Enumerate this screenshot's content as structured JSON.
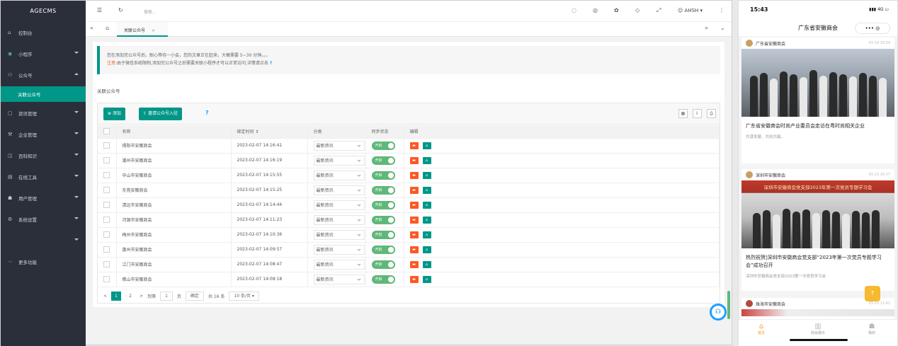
{
  "admin": {
    "brand": "AGECMS",
    "menu": [
      {
        "label": "控制台",
        "icon": "home-icon",
        "glyph": "⌂",
        "arrow": false
      },
      {
        "label": "小程序",
        "icon": "miniapp-icon",
        "glyph": "◉",
        "arrow": true
      },
      {
        "label": "公众号",
        "icon": "wechat-icon",
        "glyph": "⚇",
        "arrow": true,
        "expanded": true
      },
      {
        "label": "关联公众号",
        "icon": "",
        "glyph": "",
        "arrow": false,
        "active": true
      },
      {
        "label": "资讯管理",
        "icon": "news-icon",
        "glyph": "▢",
        "arrow": true
      },
      {
        "label": "企业管理",
        "icon": "company-icon",
        "glyph": "⚒",
        "arrow": true
      },
      {
        "label": "百科知识",
        "icon": "wiki-icon",
        "glyph": "◫",
        "arrow": true
      },
      {
        "label": "在线工具",
        "icon": "tools-icon",
        "glyph": "▤",
        "arrow": true
      },
      {
        "label": "用户管理",
        "icon": "user-icon",
        "glyph": "☗",
        "arrow": true
      },
      {
        "label": "系统设置",
        "icon": "settings-icon",
        "glyph": "⚙",
        "arrow": true
      },
      {
        "label": "",
        "icon": "",
        "glyph": "",
        "arrow": true
      },
      {
        "label": "更多功能",
        "icon": "more-icon",
        "glyph": "⋯",
        "arrow": false
      }
    ],
    "topbar": {
      "search_placeholder": "搜索...",
      "user": "AHSH"
    },
    "tab": {
      "label": "关联公众号",
      "close": "×"
    },
    "notice": {
      "line1": "您在添加完公众号后，耐心等待一小会，您的文章正在赶来，大概需要 5~30 分钟。。。",
      "warn_prefix": "注意:",
      "line2": "由于微信系统限制,添加完公众号之后需要关联小程序才可以正常访问,详情请点击",
      "help": "?"
    },
    "section_label": "关联公众号",
    "toolbar": {
      "add": "添加",
      "invite": "邀请公众号入驻",
      "help": "?"
    },
    "columns": [
      "名称",
      "绑定时间",
      "分类",
      "同步状态",
      "编辑"
    ],
    "sort_mark": "⇕",
    "rows": [
      {
        "name": "揭阳市安徽商会",
        "time": "2023-02-07 14:16:41",
        "category": "最新资讯",
        "sync": "开启"
      },
      {
        "name": "潮州市安徽商会",
        "time": "2023-02-07 14:16:19",
        "category": "最新资讯",
        "sync": "开启"
      },
      {
        "name": "中山市安徽商会",
        "time": "2023-02-07 14:15:55",
        "category": "最新资讯",
        "sync": "开启"
      },
      {
        "name": "东莞安徽商会",
        "time": "2023-02-07 14:15:25",
        "category": "最新资讯",
        "sync": "开启"
      },
      {
        "name": "清远市安徽商会",
        "time": "2023-02-07 14:14:44",
        "category": "最新资讯",
        "sync": "开启"
      },
      {
        "name": "河源市安徽商会",
        "time": "2023-02-07 14:11:23",
        "category": "最新资讯",
        "sync": "开启"
      },
      {
        "name": "梅州市安徽商会",
        "time": "2023-02-07 14:10:36",
        "category": "最新资讯",
        "sync": "开启"
      },
      {
        "name": "惠州市安徽商会",
        "time": "2023-02-07 14:09:57",
        "category": "最新资讯",
        "sync": "开启"
      },
      {
        "name": "江门市安徽商会",
        "time": "2023-02-07 14:08:47",
        "category": "最新资讯",
        "sync": "开启"
      },
      {
        "name": "佛山市安徽商会",
        "time": "2023-02-07 14:08:18",
        "category": "最新资讯",
        "sync": "开启"
      }
    ],
    "pager": {
      "prev": "<",
      "pages": [
        "1",
        "2"
      ],
      "next": ">",
      "goto": "到第",
      "page_value": "1",
      "page_unit": "页",
      "confirm": "确定",
      "total": "共 16 条",
      "per_page": "10 条/页"
    }
  },
  "phone": {
    "time": "15:43",
    "signal": "4G",
    "title": "广东省安徽商会",
    "capsule": "••• ◎",
    "cards": [
      {
        "org": "广东省安徽商会",
        "date": "03-14 10:54",
        "title": "广东省安徽商会时尚产业委员会走访在粤时尚相关企业",
        "sub": "共谋发展、共创共赢。"
      },
      {
        "org": "深圳市安徽商会",
        "date": "03-13 16:17",
        "banner": "深圳市安徽商会党支部2023年第一次党员专题学习会",
        "title": "热烈祝贺|深圳市安徽商会党支部“2023年第一次党员专题学习会”成功召开",
        "sub": "深圳市安徽商会党支部2023第一次党员学习会"
      },
      {
        "org": "珠海市安徽商会",
        "date": "03-13 11:41"
      }
    ],
    "tabs": [
      "首页",
      "商会展示",
      "我的"
    ],
    "to_top": "↑"
  }
}
